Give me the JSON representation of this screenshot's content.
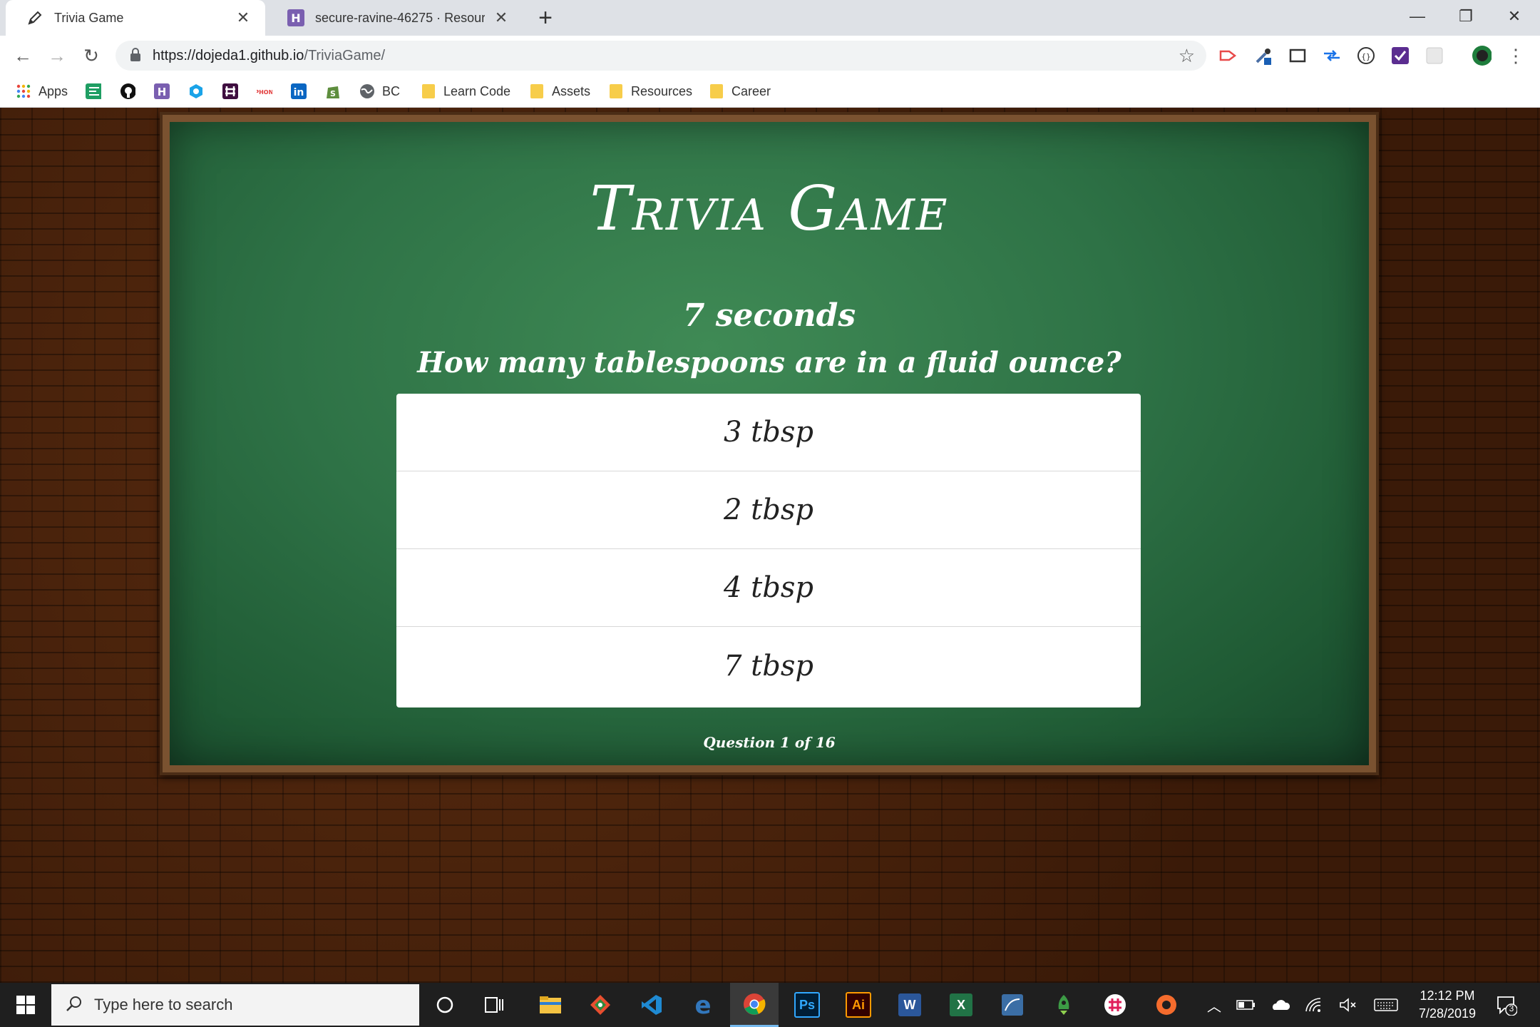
{
  "browser": {
    "tabs": [
      {
        "title": "Trivia Game",
        "active": true,
        "favicon": "pencil-icon"
      },
      {
        "title": "secure-ravine-46275 · Resources",
        "active": false,
        "favicon": "heroku-icon"
      }
    ],
    "url": {
      "base": "https://dojeda1.github.io",
      "path": "/TriviaGame/"
    },
    "bookmarks": [
      {
        "label": "Apps",
        "icon": "apps-grid-icon"
      },
      {
        "label": "",
        "icon": "bookmark-green-icon"
      },
      {
        "label": "",
        "icon": "github-icon"
      },
      {
        "label": "",
        "icon": "heroku-icon"
      },
      {
        "label": "",
        "icon": "blue-hex-icon"
      },
      {
        "label": "",
        "icon": "slack-icon"
      },
      {
        "label": "",
        "icon": "phone-icon"
      },
      {
        "label": "",
        "icon": "linkedin-icon"
      },
      {
        "label": "",
        "icon": "shopify-icon"
      },
      {
        "label": "BC",
        "icon": "globe-icon"
      },
      {
        "label": "Learn Code",
        "icon": "folder-icon"
      },
      {
        "label": "Assets",
        "icon": "folder-icon"
      },
      {
        "label": "Resources",
        "icon": "folder-icon"
      },
      {
        "label": "Career",
        "icon": "folder-icon"
      }
    ]
  },
  "game": {
    "title": "Trivia Game",
    "timer": "7 seconds",
    "question": "How many tablespoons are in a fluid ounce?",
    "answers": [
      "3 tbsp",
      "2 tbsp",
      "4 tbsp",
      "7 tbsp"
    ],
    "progress": "Question 1 of 16"
  },
  "taskbar": {
    "search_placeholder": "Type here to search",
    "time": "12:12 PM",
    "date": "7/28/2019",
    "notification_count": "3"
  },
  "colors": {
    "chalkboard": "#2e7246",
    "frame": "#7a5230",
    "brick": "#3e1d0a"
  }
}
